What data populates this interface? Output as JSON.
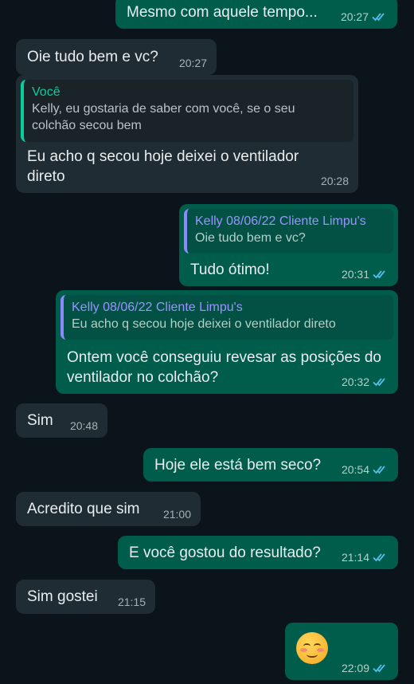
{
  "messages": [
    {
      "type": "out",
      "text": "Mesmo com aquele tempo...",
      "time": "20:27"
    },
    {
      "type": "in",
      "text": "Oie tudo bem e vc?",
      "time": "20:27"
    },
    {
      "type": "in",
      "quote_author": "Você",
      "quote_text": "Kelly, eu gostaria de saber com você, se o seu colchão secou bem",
      "text": "Eu acho q secou hoje deixei o ventilador direto",
      "time": "20:28"
    },
    {
      "type": "out",
      "quote_author": "Kelly 08/06/22 Cliente Limpu's",
      "quote_text": "Oie tudo bem e vc?",
      "text": "Tudo ótimo!",
      "time": "20:31"
    },
    {
      "type": "out",
      "quote_author": "Kelly 08/06/22 Cliente Limpu's",
      "quote_text": "Eu acho q secou hoje deixei o ventilador direto",
      "text": "Ontem você conseguiu revesar as posições do ventilador no colchão?",
      "time": "20:32"
    },
    {
      "type": "in",
      "text": "Sim",
      "time": "20:48"
    },
    {
      "type": "out",
      "text": "Hoje ele está bem seco?",
      "time": "20:54"
    },
    {
      "type": "in",
      "text": "Acredito que sim",
      "time": "21:00"
    },
    {
      "type": "out",
      "text": "E você gostou do resultado?",
      "time": "21:14"
    },
    {
      "type": "in",
      "text": "Sim gostei",
      "time": "21:15"
    },
    {
      "type": "out",
      "emoji": "smiling-face-with-smiling-eyes",
      "time": "22:09"
    }
  ],
  "colors": {
    "background": "#0b141a",
    "incoming": "#202c33",
    "outgoing": "#005c4b",
    "read_tick": "#53bdeb"
  }
}
